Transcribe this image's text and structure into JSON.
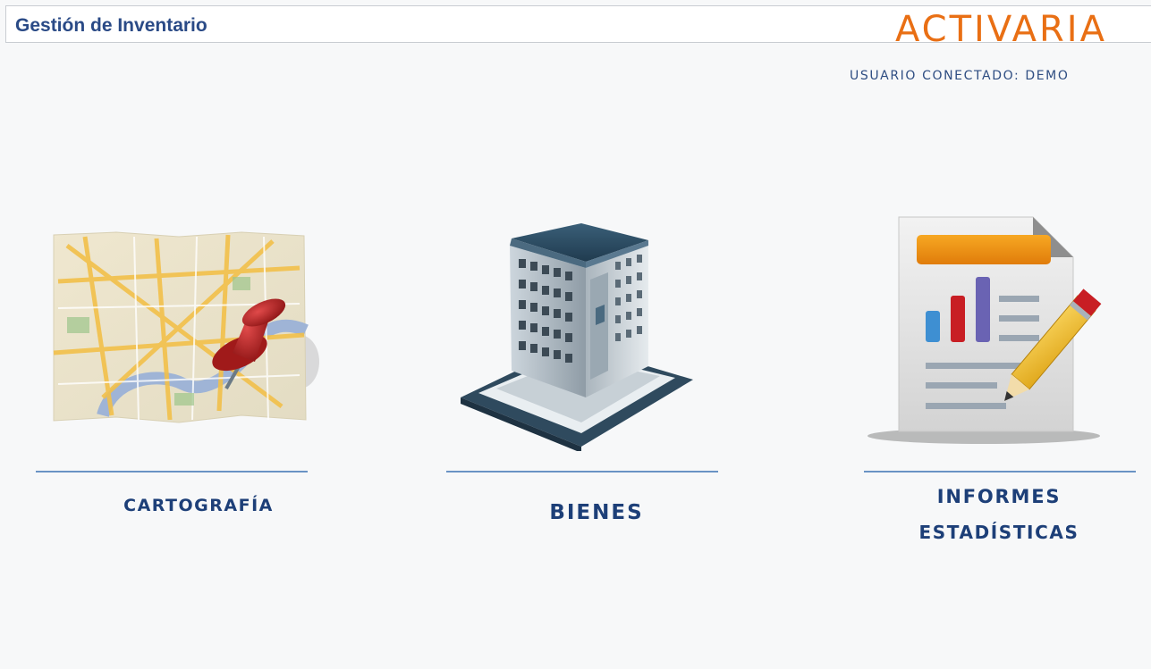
{
  "header": {
    "title": "Gestión de Inventario",
    "brand": "ACTIVARIA"
  },
  "session": {
    "user_label": "USUARIO CONECTADO: DEMO"
  },
  "modules": [
    {
      "label": "CARTOGRAFÍA",
      "icon": "map-pin-icon"
    },
    {
      "label": "BIENES",
      "icon": "building-icon"
    },
    {
      "label_line1": "Informes",
      "label_line2": "estadísticas",
      "icon": "report-chart-icon"
    }
  ],
  "colors": {
    "accent": "#e96f14",
    "label": "#1d3f78",
    "divider": "#6a93c4"
  }
}
